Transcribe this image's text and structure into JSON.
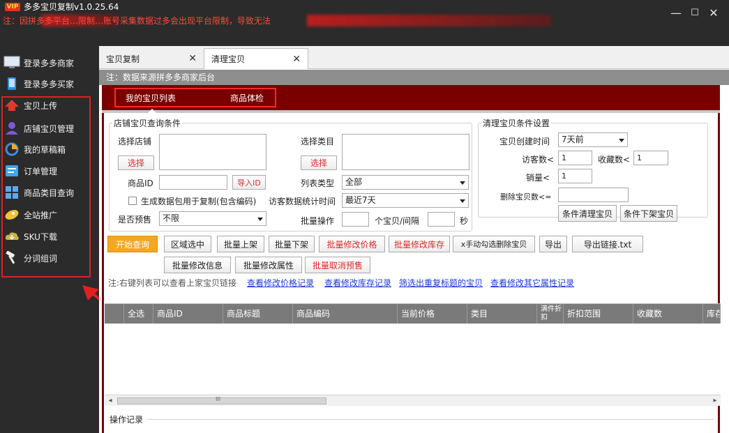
{
  "titlebar": {
    "vip_badge": "VIP",
    "app_title": "多多宝贝复制v1.0.25.64",
    "warning": "注：因拼多多平台…限制…账号采集数据过多会出现平台限制，导致无法",
    "minimize": "—",
    "maximize": "☐",
    "close": "✕"
  },
  "sidebar": {
    "items": [
      {
        "label": "登录多多商家",
        "icon": "monitor-icon"
      },
      {
        "label": "登录多多买家",
        "icon": "phone-icon"
      },
      {
        "label": "宝贝上传",
        "icon": "upload-cloud-icon"
      },
      {
        "label": "店铺宝贝管理",
        "icon": "user-icon"
      },
      {
        "label": "我的草稿箱",
        "icon": "pie-chart-icon"
      },
      {
        "label": "订单管理",
        "icon": "list-icon"
      },
      {
        "label": "商品类目查询",
        "icon": "grid-icon"
      },
      {
        "label": "全站推广",
        "icon": "rocket-icon"
      },
      {
        "label": "SKU下载",
        "icon": "cloud-download-icon"
      },
      {
        "label": "分词组词",
        "icon": "hammer-icon"
      }
    ]
  },
  "tabs": [
    {
      "label": "宝贝复制"
    },
    {
      "label": "清理宝贝"
    }
  ],
  "note": "注：数据来源拼多多商家后台",
  "subtabs": [
    "我的宝贝列表",
    "商品体检"
  ],
  "query": {
    "legend": "店铺宝贝查询条件",
    "select_shop": "选择店铺",
    "select_btn": "选择",
    "select_category": "选择类目",
    "select_btn2": "选择",
    "product_id": "商品ID",
    "import_id": "导入ID",
    "list_type": "列表类型",
    "list_type_value": "全部",
    "gen_checkbox": "生成数据包用于复制(包含编码)",
    "visitor_period": "访客数据统计时间",
    "visitor_period_value": "最近7天",
    "presale": "是否预售",
    "presale_value": "不限",
    "batch_op": "批量操作",
    "per_interval": "个宝贝/间隔",
    "seconds": "秒"
  },
  "clean": {
    "legend": "清理宝贝条件设置",
    "created": "宝贝创建时间",
    "created_value": "7天前",
    "visitors": "访客数<",
    "visitors_value": "1",
    "favorites": "收藏数<",
    "favorites_value": "1",
    "sales": "销量<",
    "sales_value": "1",
    "delete_count": "删除宝贝数<=",
    "btn_clean": "条件清理宝贝",
    "btn_offshelf": "条件下架宝贝"
  },
  "actions": {
    "start": "开始查询",
    "region": "区域选中",
    "batch_on": "批量上架",
    "batch_off": "批量下架",
    "batch_price": "批量修改价格",
    "batch_stock": "批量修改库存",
    "manual_delete": "x手动勾选删除宝贝",
    "export": "导出",
    "export_links": "导出链接.txt",
    "batch_info": "批量修改信息",
    "batch_attr": "批量修改属性",
    "cancel_presale": "批量取消预售"
  },
  "hint": {
    "text": "注:右键列表可以查看上家宝贝链接",
    "links": [
      "查看修改价格记录",
      "查看修改库存记录",
      "筛选出重复标题的宝贝",
      "查看修改其它属性记录"
    ]
  },
  "grid": {
    "columns": [
      "",
      "全选",
      "商品ID",
      "商品标题",
      "商品编码",
      "当前价格",
      "类目",
      "满件折扣",
      "折扣范围",
      "收藏数",
      "库存"
    ]
  },
  "scroll_mid": "III",
  "log": {
    "label": "操作记录"
  }
}
